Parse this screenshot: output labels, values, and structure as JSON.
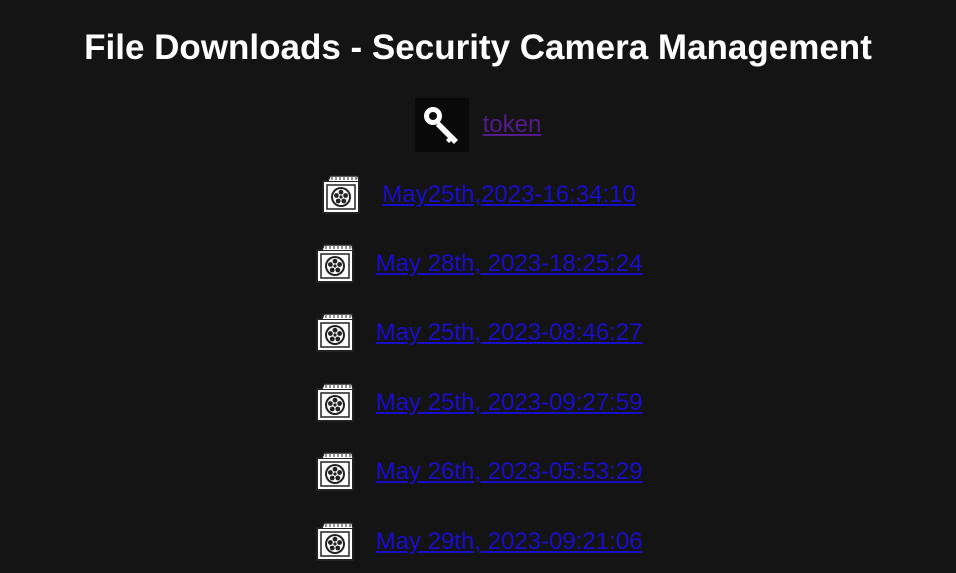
{
  "title": "File Downloads - Security Camera Management",
  "token": {
    "label": "token",
    "icon": "key-icon"
  },
  "files": [
    {
      "label": "May25th,2023-16:34:10",
      "icon": "film-reel-icon"
    },
    {
      "label": "May 28th, 2023-18:25:24",
      "icon": "film-reel-icon"
    },
    {
      "label": "May 25th, 2023-08:46:27",
      "icon": "film-reel-icon"
    },
    {
      "label": "May 25th, 2023-09:27:59",
      "icon": "film-reel-icon"
    },
    {
      "label": "May 26th, 2023-05:53:29",
      "icon": "film-reel-icon"
    },
    {
      "label": "May 29th, 2023-09:21:06",
      "icon": "film-reel-icon"
    }
  ],
  "colors": {
    "background": "#141414",
    "title": "#ffffff",
    "link": "#1a0dcc",
    "visited_link": "#551a8b"
  }
}
